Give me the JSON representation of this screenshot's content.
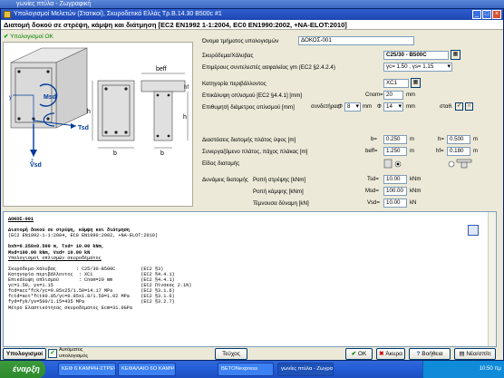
{
  "topbar_title": "γωνίες πτύλα - Ζωγραφική",
  "window": {
    "title": "Υπολογισμοί Μελετών (Στατικοί), Σκυροδετικά Ελλάς Τρ.Β.14.30 Β500c #1",
    "heading": "Διατομή δοκού σε στρέψη, κάμψη και διάτμηση [EC2 EN1992 1-1:2004, EC0 EN1990:2002, +NA-ELOT:2010]",
    "ok_text": "Υπολογισμοί OK"
  },
  "diagram": {
    "labels": {
      "msd": "Msd",
      "tsd": "Tsd",
      "vsd": "Vsd",
      "beff": "beff",
      "hf": "hf",
      "b": "b",
      "h": "h",
      "y": "y",
      "z": "z"
    }
  },
  "form": {
    "name_label": "Όνομα τμήματος υπολογισμών",
    "name_value": "ΔΟΚΟΣ-001",
    "concrete_label": "Σκυρόδεμα/Χάλυβας",
    "concrete_value": "C25/30 - B500C",
    "safety_label": "Επιμέρους συντελεστές ασφαλείας γm (EC2 §2.4.2.4)",
    "safety_value": "γc= 1.50 , γs= 1.15",
    "envclass_label": "Κατηγορία περιβάλλοντος",
    "envclass_value": "XC1",
    "cover_label": "Επικάλυψη οπλισμού [EC2 §4.4.1] [mm]",
    "cover_prefix": "Cnom=",
    "cover_value": "20",
    "cover_unit": "mm",
    "bar_label": "Επιθυμητή διάμετρος οπλισμού [mm]",
    "bar_long_prefix": "συνδετήρας",
    "bar_long_symbol": "Φ",
    "bar_long_value": "8",
    "bar_long_unit": "mm",
    "bar_main_symbol": "Φ",
    "bar_main_value": "14",
    "bar_main_unit": "mm",
    "bar_stirrup_label": "σταθ.",
    "dims_label": "Διαστάσεις διατομής πλάτος ύψος [m]",
    "b_prefix": "b=",
    "b_value": "0.250",
    "b_unit": "m",
    "h_prefix": "h=",
    "h_value": "0.500",
    "h_unit": "m",
    "flange_label": "Συνεργαζόμενο πλάτος, πάχος πλάκας [m]",
    "beff_prefix": "beff=",
    "beff_value": "1.250",
    "beff_unit": "m",
    "hf_prefix": "hf=",
    "hf_value": "0.180",
    "hf_unit": "m",
    "section_type_label": "Είδος διατομής",
    "forces_label": "Δυνάμεις διατομής",
    "tsd_label": "Ροπή στρέψης [kNm]",
    "tsd_prefix": "Tsd=",
    "tsd_value": "10.00",
    "tsd_unit": "kNm",
    "msd_label": "Ροπή κάμψης [kNm]",
    "msd_prefix": "Msd=",
    "msd_value": "100.00",
    "msd_unit": "kNm",
    "vsd_label": "Τέμνουσα δύναμη [kN]",
    "vsd_prefix": "Vsd=",
    "vsd_value": "10.00",
    "vsd_unit": "kN"
  },
  "report": {
    "title": "ΔΟΚΟΣ-001",
    "line1": "Διατομή δοκού σε στρέψη, κάμψη και διάτμηση",
    "line2": "(EC2 EN1992-1-1:2004, EC0 EN1990:2002, +NA-ELOT:2010)",
    "line3": "bxh=0.250x0.500 m, Tsd= 10.00 kNm,",
    "line4": "Msd=100.00 kNm, Vsd= 10.00 kN",
    "line5": "Υπολογισμοί οπλισμών σκυροδέματος",
    "rows": [
      "Σκυρόδεμα-Χάλυβας       : C25/30-B500C         (EC2 §3)",
      "Κατηγορία περιβάλλοντος  : XC1                 (EC2 §4.4.1)",
      "Επικάλυψη οπλισμού       : Cnom=20 mm          (EC2 §4.4.1)",
      "γc=1.50, γs=1.15                               (EC2 Πίνακας 2.1N)",
      "fcd=acc*fck/γc=0.85x25/1.50=14.17 MPa          (EC2 §3.1.6)",
      "fctd=act*fctk0.05/γc=0.85x1.8/1.50=1.02 MPa    (EC2 §3.1.6)",
      "fyd=fyk/γs=500/1.15=435 MPa                    (EC2 §3.2.7)",
      "Μέτρο Ελαστικότητας σκυροδέματος Ecm=31.0GPa"
    ]
  },
  "bottom": {
    "calc_button": "Υπολογισμοί",
    "auto_calc_label": "Αυτόματος υπολογισμός",
    "print_button": "Τεύχος",
    "ok_button": "OK",
    "cancel_button": "Άκυρα",
    "help_button": "Βοήθεια",
    "new_button": "Νέα/σπίτι"
  },
  "taskbar": {
    "start": "έναρξη",
    "tasks": [
      "ΚΕΦ 6 ΚΑΜΨΗ-ΣΤΡΕΨΗ",
      "ΚΕΦΑΛΑΙΟ 6Ο ΚΑΜΨ...",
      "BETONexpress",
      "γωνίες πτύλα - Ζωγραφ..."
    ],
    "clock": "10:50 πμ"
  },
  "colors": {
    "accent": "#1d47b0",
    "ok_green": "#008000",
    "window_bg": "#ece9d8"
  }
}
